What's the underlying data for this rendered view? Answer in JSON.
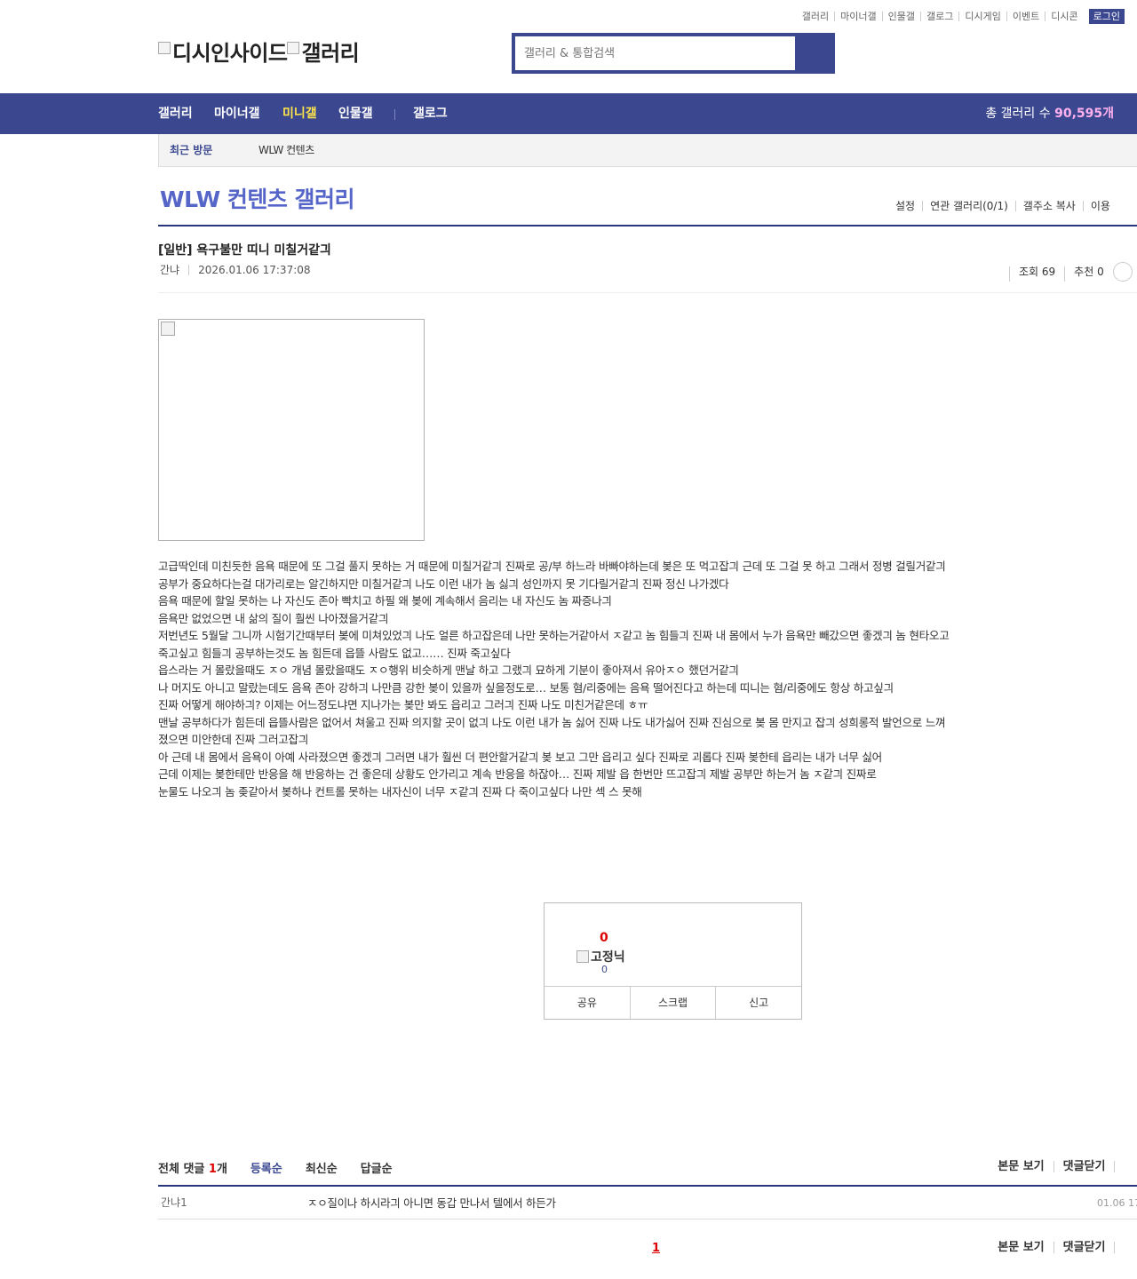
{
  "top_links": [
    "갤러리",
    "마이너갤",
    "인물갤",
    "갤로그",
    "디시게임",
    "이벤트",
    "디시콘"
  ],
  "login_label": "로그인",
  "logo": {
    "alt1": "디시인사이드",
    "alt2": "갤러리"
  },
  "search": {
    "placeholder": "갤러리 & 통합검색"
  },
  "nav": {
    "items": [
      "갤러리",
      "마이너갤",
      "미니갤",
      "인물갤",
      "갤로그"
    ],
    "active": "미니갤",
    "total_label": "총 갤러리 수",
    "total_value": "90,595개"
  },
  "subbar": {
    "recent_label": "최근 방문",
    "visited": "WLW 컨텐츠"
  },
  "gallery": {
    "title": "WLW 컨텐츠 갤러리",
    "tools": [
      "설정",
      "연관 갤러리(0/1)",
      "갤주소 복사",
      "이용"
    ]
  },
  "post": {
    "title": "[일반] 욕구불만 띠니 미칠거같긔",
    "author": "간냐",
    "date": "2026.01.06 17:37:08",
    "views": "조회 69",
    "recommends": "추천 0",
    "body": [
      "고급딱인데 미친듯한 음욕 때문에 또 그걸 풀지 못하는 거 때문에 미칠거같긔 진짜로 공/부 하느라 바빠야하는데 봊은 또 먹고잡긔 근데 또 그걸 못 하고 그래서 정병 걸릴거같긔 공부가 중요하다는걸 대가리로는 알긴하지만 미칠거같긔 나도 이런 내가 놈 싫긔 성인까지 못 기다릴거같긔 진짜 정신 나가겠다",
      "음욕 때문에 할일 못하는 나 자신도 존아 빡치고 하필 왜 봊에 계속해서 음리는 내 자신도 놈 짜증나긔",
      "음욕만 없었으면 내 삶의 질이 훨씬 나아졌을거같긔",
      "저번년도 5월달 그니까 시험기간때부터 봊에 미쳐있었긔 나도 얼른 하고잡은데 나만 못하는거같아서 ㅈ같고 놈 힘들긔 진짜 내 몸에서 누가 음욕만 빼갔으면 좋겠긔 놈 현타오고 죽고싶고 힘들긔 공부하는것도 놈 힘든데 읍뜰 사람도 없고…… 진짜 죽고싶다",
      "읍스라는 거 몰랐을때도 ㅈㅇ 개념 몰랐을때도 ㅈㅇ행위 비슷하게 맨날 하고 그랬긔 묘하게 기분이 좋아져서 유아ㅈㅇ 했던거같긔",
      "나 머지도 아니고 말랐는데도 음욕 존아 강하긔 나만큼 강한 봊이 있을까 싶을정도로… 보통 혐/리중에는 음욕 떨어진다고 하는데 띠니는 혐/리중에도 항상 하고싶긔",
      "진짜 어떻게 해야하긔? 이제는 어느정도냐면 지나가는 봊만 봐도 읍리고 그러긔 진짜 나도 미친거같은데 ㅎㅠ",
      "맨날 공부하다가 힘든데 읍뜰사람은 없어서 쳐울고 진짜 의지할 곳이 없긔 나도 이런 내가 놈 싫어 진짜 나도 내가싫어 진짜 진심으로 봊 몸 만지고 잡긔 성희롱적 발언으로 느껴졌으면 미안한데 진짜 그러고잡긔",
      "아 근데 내 몸에서 음욕이 아예 사라졌으면 좋겠긔 그러면 내가 훨씬 더 편안할거같긔 봊 보고 그만 읍리고 싶다 진짜로 괴롭다 진짜 봊한테 읍리는 내가 너무 싫어",
      "근데 이제는 봊한테만 반응을 해 반응하는 건 좋은데 상황도 안가리고 계속 반응을 하잖아… 진짜 제발 읍 한번만 뜨고잡긔 제발 공부만 하는거 놈 ㅈ같긔 진짜로",
      "눈물도 나오긔 놈 좆같아서 봊하나 컨트롤 못하는 내자신이 너무 ㅈ같긔 진짜 다 죽이고싶다 나만 섹 스 못해"
    ]
  },
  "recommend_box": {
    "count": "0",
    "fix_label": "고정닉",
    "fix_count": "0",
    "buttons": [
      "공유",
      "스크랩",
      "신고"
    ]
  },
  "comments": {
    "total_label": "전체 댓글",
    "total_count": "1",
    "total_suffix": "개",
    "orders": [
      "등록순",
      "최신순",
      "답글순"
    ],
    "right_links": [
      "본문 보기",
      "댓글닫기"
    ],
    "items": [
      {
        "nick": "간냐1",
        "memo": "ㅈㅇ질이나 하시라긔 아니면 동갑 만나서 텔에서 하든가",
        "date": "01.06 17"
      }
    ],
    "page": "1"
  }
}
